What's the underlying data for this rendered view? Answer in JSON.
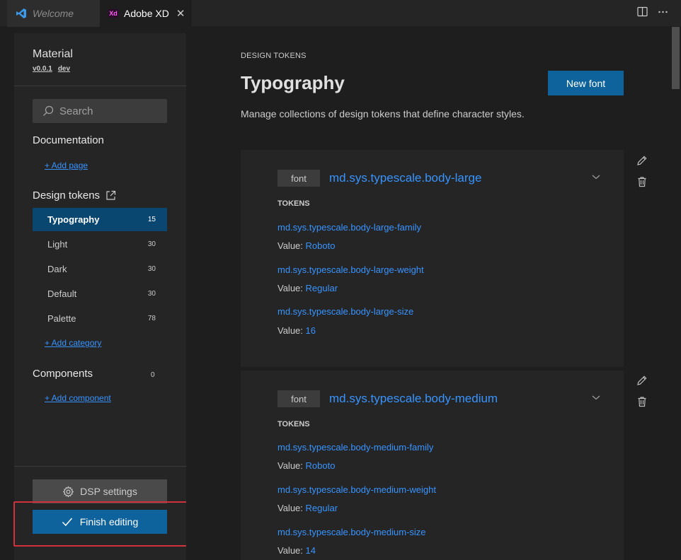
{
  "tabs": {
    "welcome": "Welcome",
    "xd": "Adobe XD",
    "xd_badge": "Xd",
    "close": "✕"
  },
  "sidebar": {
    "title": "Material",
    "version": "v0.0.1",
    "branch": "dev",
    "search_placeholder": "Search",
    "documentation": {
      "heading": "Documentation",
      "add": "+ Add page"
    },
    "design_tokens": {
      "heading": "Design tokens",
      "categories": [
        {
          "label": "Typography",
          "count": "15"
        },
        {
          "label": "Light",
          "count": "30"
        },
        {
          "label": "Dark",
          "count": "30"
        },
        {
          "label": "Default",
          "count": "30"
        },
        {
          "label": "Palette",
          "count": "78"
        }
      ],
      "add": "+ Add category"
    },
    "components": {
      "heading": "Components",
      "count": "0",
      "add": "+ Add component"
    },
    "dsp_settings": "DSP settings",
    "finish_editing": "Finish editing"
  },
  "main": {
    "eyebrow": "DESIGN TOKENS",
    "title": "Typography",
    "new_font": "New font",
    "description": "Manage collections of design tokens that define character styles.",
    "cards": [
      {
        "tag": "font",
        "name": "md.sys.typescale.body-large",
        "tokens_heading": "TOKENS",
        "tokens": [
          {
            "name": "md.sys.typescale.body-large-family",
            "value_label": "Value:",
            "value": "Roboto"
          },
          {
            "name": "md.sys.typescale.body-large-weight",
            "value_label": "Value:",
            "value": "Regular"
          },
          {
            "name": "md.sys.typescale.body-large-size",
            "value_label": "Value:",
            "value": "16"
          }
        ]
      },
      {
        "tag": "font",
        "name": "md.sys.typescale.body-medium",
        "tokens_heading": "TOKENS",
        "tokens": [
          {
            "name": "md.sys.typescale.body-medium-family",
            "value_label": "Value:",
            "value": "Roboto"
          },
          {
            "name": "md.sys.typescale.body-medium-weight",
            "value_label": "Value:",
            "value": "Regular"
          },
          {
            "name": "md.sys.typescale.body-medium-size",
            "value_label": "Value:",
            "value": "14"
          }
        ]
      }
    ]
  },
  "colors": {
    "accent": "#0e639c",
    "link": "#3794ff",
    "highlight": "#d0313a"
  }
}
